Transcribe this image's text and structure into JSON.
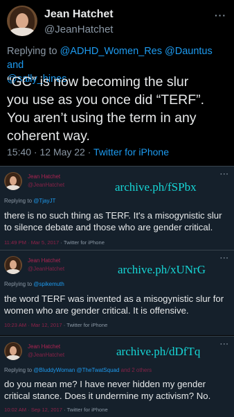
{
  "main_tweet": {
    "name": "Jean Hatchet",
    "handle": "@JeanHatchet",
    "replying_prefix": "Replying to",
    "replying_mentions_1": "@ADHD_Women_Res @Dauntus and",
    "replying_mentions_2": "@sally_hines",
    "lines": [
      "“GC” is now becoming the slur",
      "you use as you once did “TERF”.",
      "You aren’t using the term in any",
      "coherent way."
    ],
    "time": "15:40 · 12 May 22 ·",
    "source": "Twitter for iPhone",
    "more_icon": "more-horizontal-icon"
  },
  "archived": [
    {
      "name": "Jean Hatchet",
      "handle": "@JeanHatchet",
      "archive_label": "archive.ph/fSPbx",
      "replying_prefix": "Replying to",
      "replying_mentions": "@TjayJT",
      "replying_suffix": "",
      "lines": [
        "there is no such thing as TERF. It's a misogynistic slur",
        "to silence debate and those who are gender critical."
      ],
      "time": "11:49 PM · Mar 5, 2017",
      "source": "· Twitter for iPhone"
    },
    {
      "name": "Jean Hatchet",
      "handle": "@JeanHatchet",
      "archive_label": "archive.ph/xUNrG",
      "replying_prefix": "Replying to",
      "replying_mentions": "@spikemuth",
      "replying_suffix": "",
      "lines": [
        "the word TERF was invented as a misogynistic slur for",
        "women who are gender critical. It is offensive."
      ],
      "time": "10:23 AM · Mar 12, 2017",
      "source": "· Twitter for iPhone"
    },
    {
      "name": "Jean Hatchet",
      "handle": "@JeanHatchet",
      "archive_label": "archive.ph/dDfTq",
      "replying_prefix": "Replying to",
      "replying_mentions": "@BluddyWoman @TheTwatSquad",
      "replying_suffix": "and 2 others",
      "lines": [
        "do you mean me? I have never hidden my gender",
        "critical stance. Does it undermine my activism? No."
      ],
      "time": "10:02 AM · Sep 12, 2017",
      "source": "· Twitter for iPhone"
    }
  ],
  "colors": {
    "background": "#000000",
    "card": "#15202b",
    "link": "#1d9bf0",
    "archive": "#16d6d6",
    "text": "#e7e9ea",
    "muted": "#8b98a5"
  }
}
